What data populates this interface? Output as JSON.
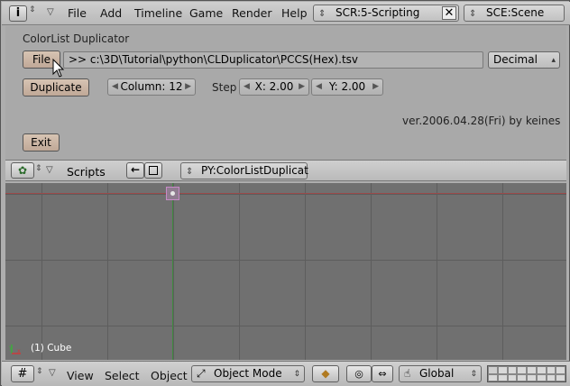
{
  "topbar": {
    "menus": [
      "File",
      "Add",
      "Timeline",
      "Game",
      "Render",
      "Help"
    ],
    "screen": "SCR:5-Scripting",
    "scene": "SCE:Scene"
  },
  "script": {
    "title": "ColorList Duplicator",
    "file_button": "File",
    "path": ">> c:\\3D\\Tutorial\\python\\CLDuplicator\\PCCS(Hex).tsv",
    "format_select": "Decimal",
    "duplicate_button": "Duplicate",
    "column": "Column: 12",
    "step_label": "Step",
    "x_step": "X: 2.00",
    "y_step": "Y: 2.00",
    "version": "ver.2006.04.28(Fri) by keines",
    "exit_button": "Exit"
  },
  "scripts_header": {
    "label": "Scripts",
    "script_name": "PY:ColorListDuplicat"
  },
  "viewport": {
    "object_label": "(1) Cube"
  },
  "bottombar": {
    "menus": [
      "View",
      "Select",
      "Object"
    ],
    "mode": "Object Mode",
    "orientation": "Global"
  }
}
